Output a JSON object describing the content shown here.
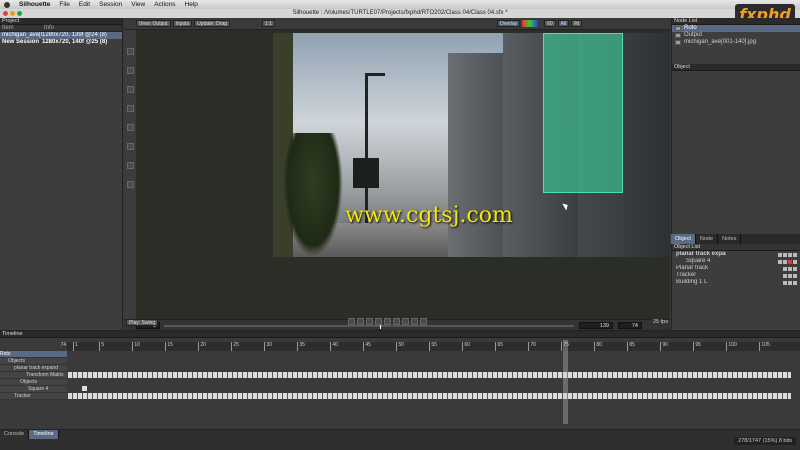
{
  "menubar": {
    "app": "Silhouette",
    "items": [
      "File",
      "Edit",
      "Session",
      "View",
      "Actions",
      "Help"
    ]
  },
  "window": {
    "title": "Silhouette : /Volumes/TURTLE07/Projects/fxphd/RTO202/Class 04/Class 04.sfx *"
  },
  "logo": {
    "text": "fxphd"
  },
  "project": {
    "title": "Project",
    "columns": [
      "Item",
      "Info"
    ],
    "rows": [
      {
        "item": "michigan_ave[0...",
        "info": "1280x720, 139f @24 (8)"
      },
      {
        "item": "New Session",
        "info": "1280x720, 140f @25 (8)"
      }
    ]
  },
  "viewer": {
    "view": "View: Output",
    "inputs": "Inputs",
    "update": "Update: Drag",
    "zoom": "1:1",
    "overlay": "Overlay",
    "all": "All",
    "channel": "Rt",
    "value": "60"
  },
  "watermark": "www.cgtsj.com",
  "scrubber": {
    "start": "1",
    "end": "139",
    "current": "74",
    "fps": "25",
    "fps_unit": "fps",
    "playmode": "Play: Swing"
  },
  "nodelist": {
    "title": "Node List",
    "nodes": [
      "Roto",
      "Output",
      "michigan_ave[001-140].jpg"
    ]
  },
  "object_panel": {
    "title": "Object"
  },
  "object_tabs": [
    "Object",
    "Node",
    "Notes"
  ],
  "object_list": {
    "title": "Object List",
    "items": [
      "planar track expand",
      "Square 4",
      "Planar track",
      "Tracker",
      "Building 1 L"
    ]
  },
  "timeline": {
    "title": "Timeline",
    "frame": "74",
    "ticks": [
      "1",
      "5",
      "10",
      "15",
      "20",
      "25",
      "30",
      "35",
      "40",
      "45",
      "50",
      "55",
      "60",
      "65",
      "70",
      "75",
      "80",
      "85",
      "90",
      "95",
      "100",
      "105"
    ],
    "rows": [
      "Roto",
      "Objects",
      "planar track expand",
      "Transform Matrix",
      "Objects",
      "Square 4",
      "Tracker"
    ]
  },
  "bottom_tabs": [
    "Console",
    "Timeline"
  ],
  "status": "278/1747 (15%) 8 bits"
}
